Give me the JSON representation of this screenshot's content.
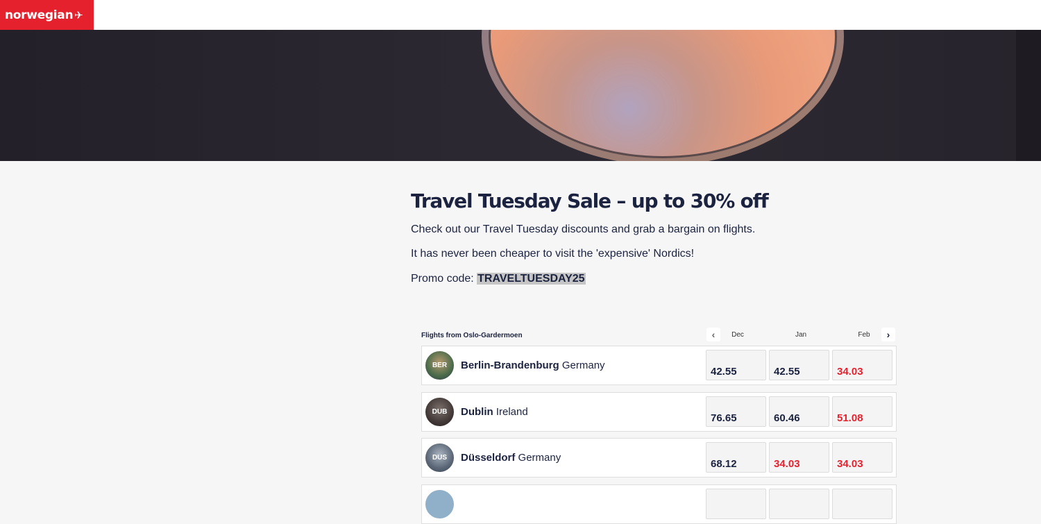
{
  "header": {
    "logo_text": "norwegian",
    "logo_glyph": "✈"
  },
  "article": {
    "title": "Travel Tuesday Sale – up to 30% off",
    "para1": "Check out our Travel Tuesday discounts and grab a bargain on flights.",
    "para2": "It has never been cheaper to visit the 'expensive' Nordics!",
    "promo_label": "Promo code: ",
    "promo_code": "TRAVELTUESDAY25"
  },
  "flights": {
    "from_label": "Flights from Oslo-Gardermoen",
    "prev_glyph": "‹",
    "next_glyph": "›",
    "months": [
      "Dec",
      "Jan",
      "Feb"
    ],
    "rows": [
      {
        "code": "BER",
        "city": "Berlin-Brandenburg",
        "country": "Germany",
        "prices": [
          "42.55",
          "42.55",
          "34.03"
        ],
        "low": [
          false,
          false,
          true
        ]
      },
      {
        "code": "DUB",
        "city": "Dublin",
        "country": "Ireland",
        "prices": [
          "76.65",
          "60.46",
          "51.08"
        ],
        "low": [
          false,
          false,
          true
        ]
      },
      {
        "code": "DUS",
        "city": "Düsseldorf",
        "country": "Germany",
        "prices": [
          "68.12",
          "34.03",
          "34.03"
        ],
        "low": [
          false,
          true,
          true
        ]
      }
    ]
  },
  "colors": {
    "brand_red": "#e5212d",
    "navy": "#1b2340",
    "low_price": "#e5212d"
  }
}
